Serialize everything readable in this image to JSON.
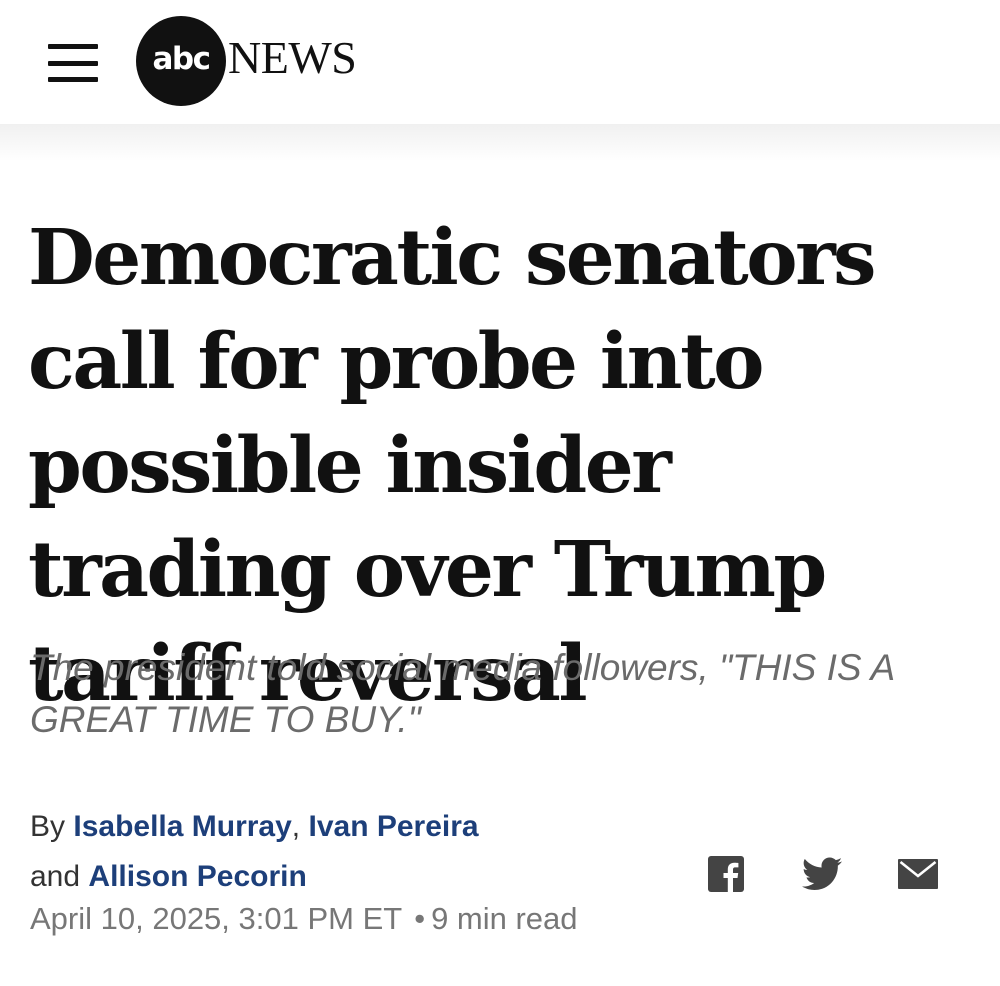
{
  "header": {
    "menu_icon": "hamburger-menu-icon",
    "logo": {
      "abc": "abc",
      "news": "NEWS"
    }
  },
  "article": {
    "headline": "Democratic senators call for probe into possible insider trading over Trump tariff reversal",
    "subhead": "The president told social media followers, \"THIS IS A GREAT TIME TO BUY.\"",
    "byline": {
      "by": "By",
      "authors": [
        "Isabella Murray",
        "Ivan Pereira",
        "Allison Pecorin"
      ],
      "comma": ",",
      "and": "and"
    },
    "date": "April 10, 2025, 3:01 PM ET",
    "separator": "•",
    "read_time": "9 min read"
  },
  "share": {
    "icons": [
      "facebook-icon",
      "twitter-icon",
      "email-icon"
    ]
  },
  "colors": {
    "author_link": "#1d3f7a",
    "subhead": "#6b6b6b",
    "icon": "#444444"
  }
}
